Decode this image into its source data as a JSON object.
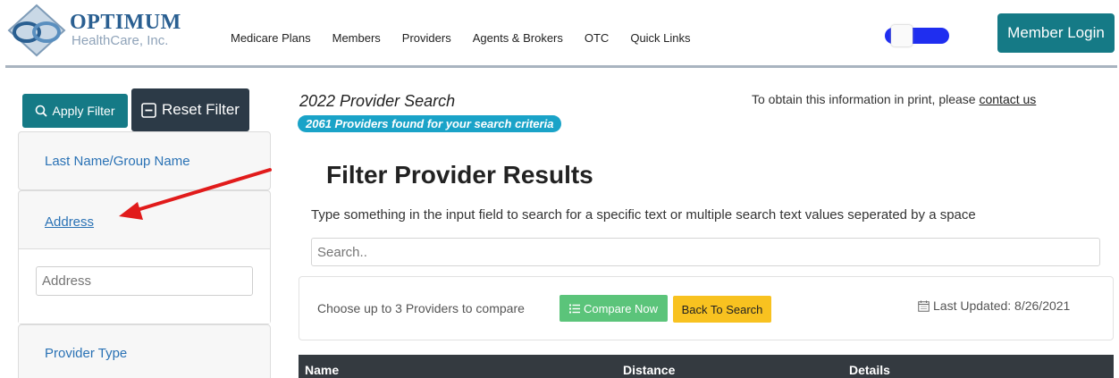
{
  "header": {
    "logo": {
      "name": "OPTIMUM",
      "subtitle": "HealthCare, Inc."
    },
    "nav": [
      "Medicare Plans",
      "Members",
      "Providers",
      "Agents & Brokers",
      "OTC",
      "Quick Links"
    ],
    "member_login": "Member Login",
    "toggle_state": "on"
  },
  "sidebar": {
    "apply_filter": "Apply Filter",
    "reset_filter": "Reset Filter",
    "last_name_label": "Last Name/Group Name",
    "address_label": "Address",
    "address_placeholder": "Address",
    "provider_type_label": "Provider Type"
  },
  "main": {
    "search_title": "2022 Provider Search",
    "found_badge": "2061 Providers found for your search criteria",
    "print_note": "To obtain this information in print, please",
    "contact_link": "contact us",
    "filter_heading": "Filter Provider Results",
    "filter_description": "Type something in the input field to search for a specific text or multiple search text values seperated by a space",
    "search_placeholder": "Search..",
    "compare_text": "Choose up to 3 Providers to compare",
    "compare_now": "Compare Now",
    "back_to_search": "Back To Search",
    "last_updated": "Last Updated: 8/26/2021",
    "table_headers": [
      "Name",
      "Distance",
      "Details"
    ]
  },
  "colors": {
    "brand_teal": "#157a86",
    "dark": "#343a40",
    "badge": "#1aa3c8",
    "compare_green": "#5bc47a",
    "back_yellow": "#f8c220",
    "toggle_blue": "#1f2ef0",
    "arrow_red": "#e11b1b"
  },
  "icons": [
    "logo-mark-icon",
    "search-icon",
    "minus-square-icon",
    "list-icon",
    "calendar-icon",
    "annotation-arrow-icon"
  ]
}
